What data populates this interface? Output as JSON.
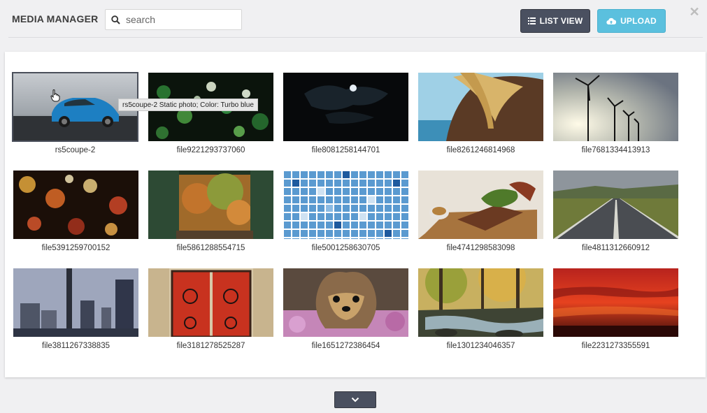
{
  "header": {
    "title": "MEDIA MANAGER",
    "search_placeholder": "search",
    "search_value": "",
    "list_view_label": "LIST VIEW",
    "upload_label": "UPLOAD",
    "close_glyph": "✕"
  },
  "media": [
    {
      "name": "rs5coupe-2",
      "selected": true,
      "scene": "car"
    },
    {
      "name": "file9221293737060",
      "scene": "bokeh-green"
    },
    {
      "name": "file8081258144701",
      "scene": "night-moon"
    },
    {
      "name": "file8261246814968",
      "scene": "horse"
    },
    {
      "name": "file7681334413913",
      "scene": "wind-turbines"
    },
    {
      "name": "file5391259700152",
      "scene": "bokeh-warm"
    },
    {
      "name": "file5861288554715",
      "scene": "autumn-window"
    },
    {
      "name": "file5001258630705",
      "scene": "blue-tiles"
    },
    {
      "name": "file4741298583098",
      "scene": "steak"
    },
    {
      "name": "file4811312660912",
      "scene": "road"
    },
    {
      "name": "file3811267338835",
      "scene": "city"
    },
    {
      "name": "file3181278525287",
      "scene": "red-door"
    },
    {
      "name": "file1651272386454",
      "scene": "dog"
    },
    {
      "name": "file1301234046357",
      "scene": "forest-stream"
    },
    {
      "name": "file2231273355591",
      "scene": "red-sky"
    }
  ],
  "tooltip": "rs5coupe-2 Static photo; Color: Turbo blue",
  "colors": {
    "dark_button": "#4a5060",
    "upload_button": "#5bc0de"
  }
}
